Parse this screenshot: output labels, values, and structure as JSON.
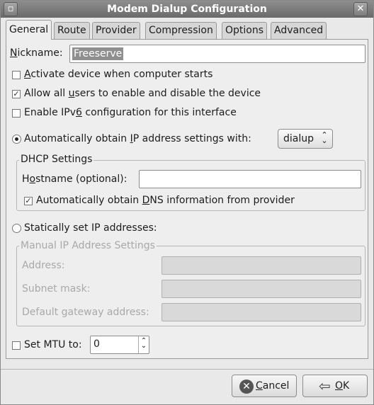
{
  "window": {
    "title": "Modem Dialup Configuration",
    "minimize_glyph": "▫",
    "close_glyph": "✕"
  },
  "tabs": [
    {
      "label": "General",
      "active": true
    },
    {
      "label": "Route",
      "active": false
    },
    {
      "label": "Provider",
      "active": false
    },
    {
      "label": "Compression",
      "active": false
    },
    {
      "label": "Options",
      "active": false
    },
    {
      "label": "Advanced",
      "active": false
    }
  ],
  "nickname": {
    "label_pre": "",
    "label_mnemonic": "N",
    "label_post": "ickname:",
    "value": "Freeserve"
  },
  "checkboxes": {
    "activate": {
      "pre": "",
      "mn": "A",
      "post": "ctivate device when computer starts",
      "checked": false
    },
    "allow_users": {
      "pre": "Allow all ",
      "mn": "u",
      "post": "sers to enable and disable the device",
      "checked": true
    },
    "ipv6": {
      "pre": "Enable IPv",
      "mn": "6",
      "post": " configuration for this interface",
      "checked": false
    }
  },
  "auto_ip": {
    "pre": "Automatically obtain ",
    "mn": "I",
    "post": "P address settings with:",
    "selected": true,
    "combo_value": "dialup",
    "combo_arrow": "⌃⌄"
  },
  "dhcp": {
    "title": "DHCP Settings",
    "hostname_pre": "H",
    "hostname_mn": "o",
    "hostname_post": "stname (optional):",
    "hostname_value": "",
    "dns_pre": "Automatically obtain ",
    "dns_mn": "D",
    "dns_post": "NS information from provider",
    "dns_checked": true
  },
  "static_ip": {
    "label": "Statically set IP addresses:",
    "selected": false
  },
  "manual": {
    "title": "Manual IP Address Settings",
    "address_label": "Address:",
    "subnet_label": "Subnet mask:",
    "gateway_label": "Default gateway address:",
    "address_value": "",
    "subnet_value": "",
    "gateway_value": ""
  },
  "mtu": {
    "label": "Set MTU to:",
    "checked": false,
    "value": "0",
    "up_arrow": "⌃",
    "down_arrow": "⌄"
  },
  "buttons": {
    "cancel_mn": "C",
    "cancel_post": "ancel",
    "cancel_icon": "✕",
    "ok_mn": "O",
    "ok_post": "K",
    "ok_icon": "⇦"
  }
}
